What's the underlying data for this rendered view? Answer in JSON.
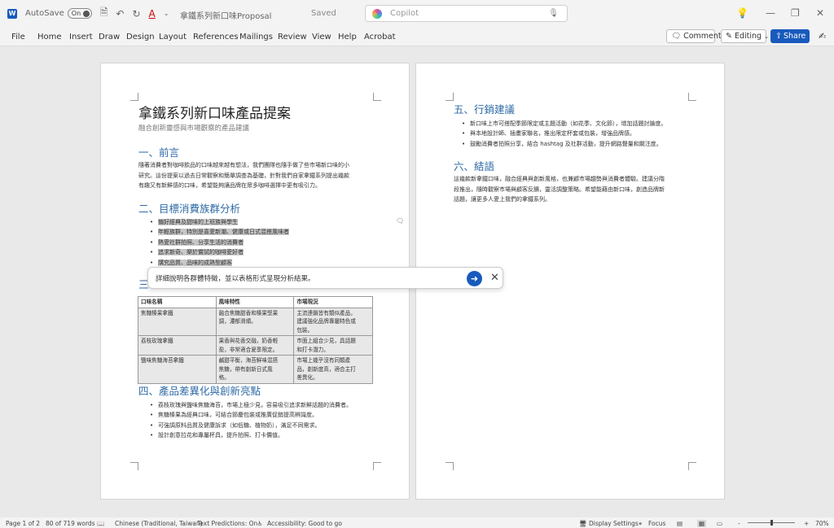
{
  "titlebar": {
    "app_letter": "W",
    "autosave_label": "AutoSave",
    "autosave_state": "On",
    "doc_title": "拿鐵系列新口味Proposal",
    "saved_label": "Saved",
    "copilot_placeholder": "Copilot"
  },
  "ribbon": {
    "tabs": [
      "File",
      "Home",
      "Insert",
      "Draw",
      "Design",
      "Layout",
      "References",
      "Mailings",
      "Review",
      "View",
      "Help",
      "Acrobat"
    ],
    "comments_label": "Comments",
    "editing_label": "Editing",
    "share_label": "Share"
  },
  "page1": {
    "title": "拿鐵系列新口味產品提案",
    "subtitle": "融合創新靈感與市場觀察的產品建議",
    "h_intro": "一、前言",
    "intro_lines": [
      "隨著消費者對咖啡飲品的口味越來越有想法，我們團隊也隨手做了些市場新口味的小",
      "研究。這份提案以過去日常觀察和簡單調查為基礎，針對我們自家拿鐵系列提出幾款",
      "有趣又有新鮮感的口味，希望能夠讓品牌在眾多咖啡選擇中更有吸引力。"
    ],
    "h_target": "二、目標消費族群分析",
    "target_items": [
      "偏好經典及甜味的上班族與學生",
      "年輕族群，特別是喜愛新潮、健康或日式混搭風味者",
      "熱愛社群拍照、分享生活的消費者",
      "追求新奇、樂於嘗試的咖啡愛好者",
      "講究品質、品味的成熟型顧客"
    ],
    "h_three": "三",
    "table": {
      "headers": [
        "口味名稱",
        "風味特性",
        "市場現況"
      ],
      "rows": [
        [
          "焦糖榛果拿鐵",
          "融合焦糖甜香和榛果堅果|調，濃郁滑順。",
          "主流連鎖皆有類似產品，|建議強化品牌專屬特色或|包裝。"
        ],
        [
          "荔枝玫瑰拿鐵",
          "果香與花香交融，奶香輕|盈，非常適合夏季限定。",
          "市面上組合少見，具話題|和打卡潛力。"
        ],
        [
          "鹽味焦糖海苔拿鐵",
          "鹹甜平衡，海苔鮮味混搭|焦糖，帶有創新日式風|格。",
          "市場上幾乎沒有同類產|品，創新度高，適合主打|差異化。"
        ]
      ]
    },
    "h_diff": "四、產品差異化與創新亮點",
    "diff_items": [
      "荔枝玫瑰與鹽味焦糖海苔，市場上極少見，容易吸引追求新鮮話題的消費者。",
      "焦糖榛果為經典口味，可結合節慶包裝或推廣促銷提高辨識度。",
      "可強調原料品質及健康訴求（如低糖、植物奶），滿足不同需求。",
      "設計創意拉花和專屬杯具，提升拍照、打卡價值。"
    ]
  },
  "page2": {
    "h_marketing": "五、行銷建議",
    "marketing_items": [
      "新口味上市可搭配季節限定或主題活動（如花季、文化節），增加話題討論度。",
      "與本地設計師、插畫家聯名，推出限定杯套或包裝，增強品牌感。",
      "鼓勵消費者拍照分享，結合 hashtag 及社群活動，提升網路聲量和關注度。"
    ],
    "h_conclusion": "六、結語",
    "conclusion_lines": [
      "這幾款新拿鐵口味，融合經典與創新風格，也兼顧市場趨勢與消費者體驗。建議分階",
      "段推出，隨時觀察市場與顧客反饋，靈活調整策略。希望能藉由新口味，創造品牌新",
      "話題，讓更多人愛上我們的拿鐵系列。"
    ]
  },
  "prompt": {
    "text": "詳細說明各群體特徵，並以表格形式呈現分析結果。"
  },
  "status": {
    "page": "Page 1 of 2",
    "words": "80 of 719 words",
    "language": "Chinese (Traditional, Taiwan)",
    "predictions": "Text Predictions: On",
    "accessibility": "Accessibility: Good to go",
    "display_settings": "Display Settings",
    "focus": "Focus",
    "zoom_minus": "-",
    "zoom_plus": "+",
    "zoom": "70%"
  }
}
